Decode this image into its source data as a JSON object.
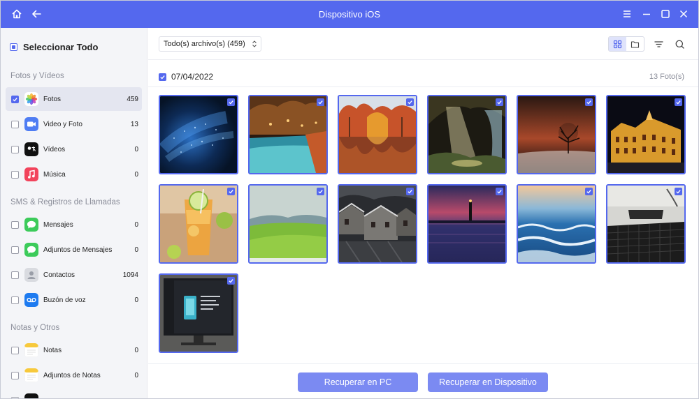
{
  "window": {
    "title": "Dispositivo iOS",
    "accent_color": "#5468ee",
    "icons": {
      "home": "home-icon",
      "back": "back-arrow-icon",
      "menu": "menu-icon",
      "minimize": "minimize-icon",
      "maximize": "maximize-icon",
      "close": "close-icon"
    }
  },
  "sidebar": {
    "select_all_label": "Seleccionar Todo",
    "sections": {
      "photos_videos": {
        "title": "Fotos y Vídeos",
        "items": [
          {
            "label": "Fotos",
            "count": "459",
            "icon": "photos-app-icon",
            "checked": true,
            "active": true
          },
          {
            "label": "Video y Foto",
            "count": "13",
            "icon": "camera-video-icon",
            "checked": false
          },
          {
            "label": "Vídeos",
            "count": "0",
            "icon": "apple-tv-icon",
            "checked": false
          },
          {
            "label": "Música",
            "count": "0",
            "icon": "music-app-icon",
            "checked": false
          }
        ]
      },
      "sms_calls": {
        "title": "SMS & Registros de Llamadas",
        "items": [
          {
            "label": "Mensajes",
            "count": "0",
            "icon": "messages-app-icon",
            "checked": false
          },
          {
            "label": "Adjuntos de Mensajes",
            "count": "0",
            "icon": "messages-attachments-icon",
            "checked": false
          },
          {
            "label": "Contactos",
            "count": "1094",
            "icon": "contacts-app-icon",
            "checked": false
          },
          {
            "label": "Buzón de voz",
            "count": "0",
            "icon": "voicemail-icon",
            "checked": false
          }
        ]
      },
      "notes_other": {
        "title": "Notas y Otros",
        "items": [
          {
            "label": "Notas",
            "count": "0",
            "icon": "notes-app-icon",
            "checked": false
          },
          {
            "label": "Adjuntos de Notas",
            "count": "0",
            "icon": "notes-attachments-icon",
            "checked": false
          }
        ]
      }
    }
  },
  "toolbar": {
    "filter_value": "Todo(s) archivo(s) (459)",
    "icons": {
      "grid": "grid-view-icon",
      "folder": "folder-view-icon",
      "filter": "filter-icon",
      "search": "search-icon"
    }
  },
  "gallery": {
    "date": "07/04/2022",
    "count_label": "13 Foto(s)",
    "photos": [
      {
        "name": "photo-blue-particles",
        "checked": true
      },
      {
        "name": "photo-resort-pool",
        "checked": true
      },
      {
        "name": "photo-autumn-lake",
        "checked": true
      },
      {
        "name": "photo-cave-light",
        "checked": true
      },
      {
        "name": "photo-lone-tree-sunset",
        "checked": true
      },
      {
        "name": "photo-lit-building-night",
        "checked": true
      },
      {
        "name": "photo-iced-tea",
        "checked": true
      },
      {
        "name": "photo-green-field",
        "checked": true
      },
      {
        "name": "photo-stone-houses",
        "checked": true
      },
      {
        "name": "photo-lighthouse-dusk",
        "checked": true
      },
      {
        "name": "photo-ocean-waves",
        "checked": true
      },
      {
        "name": "photo-keyboard-desk",
        "checked": true
      },
      {
        "name": "photo-monitor-screen",
        "checked": true
      }
    ]
  },
  "actions": {
    "recover_pc": "Recuperar en PC",
    "recover_device": "Recuperar en Dispositivo"
  }
}
